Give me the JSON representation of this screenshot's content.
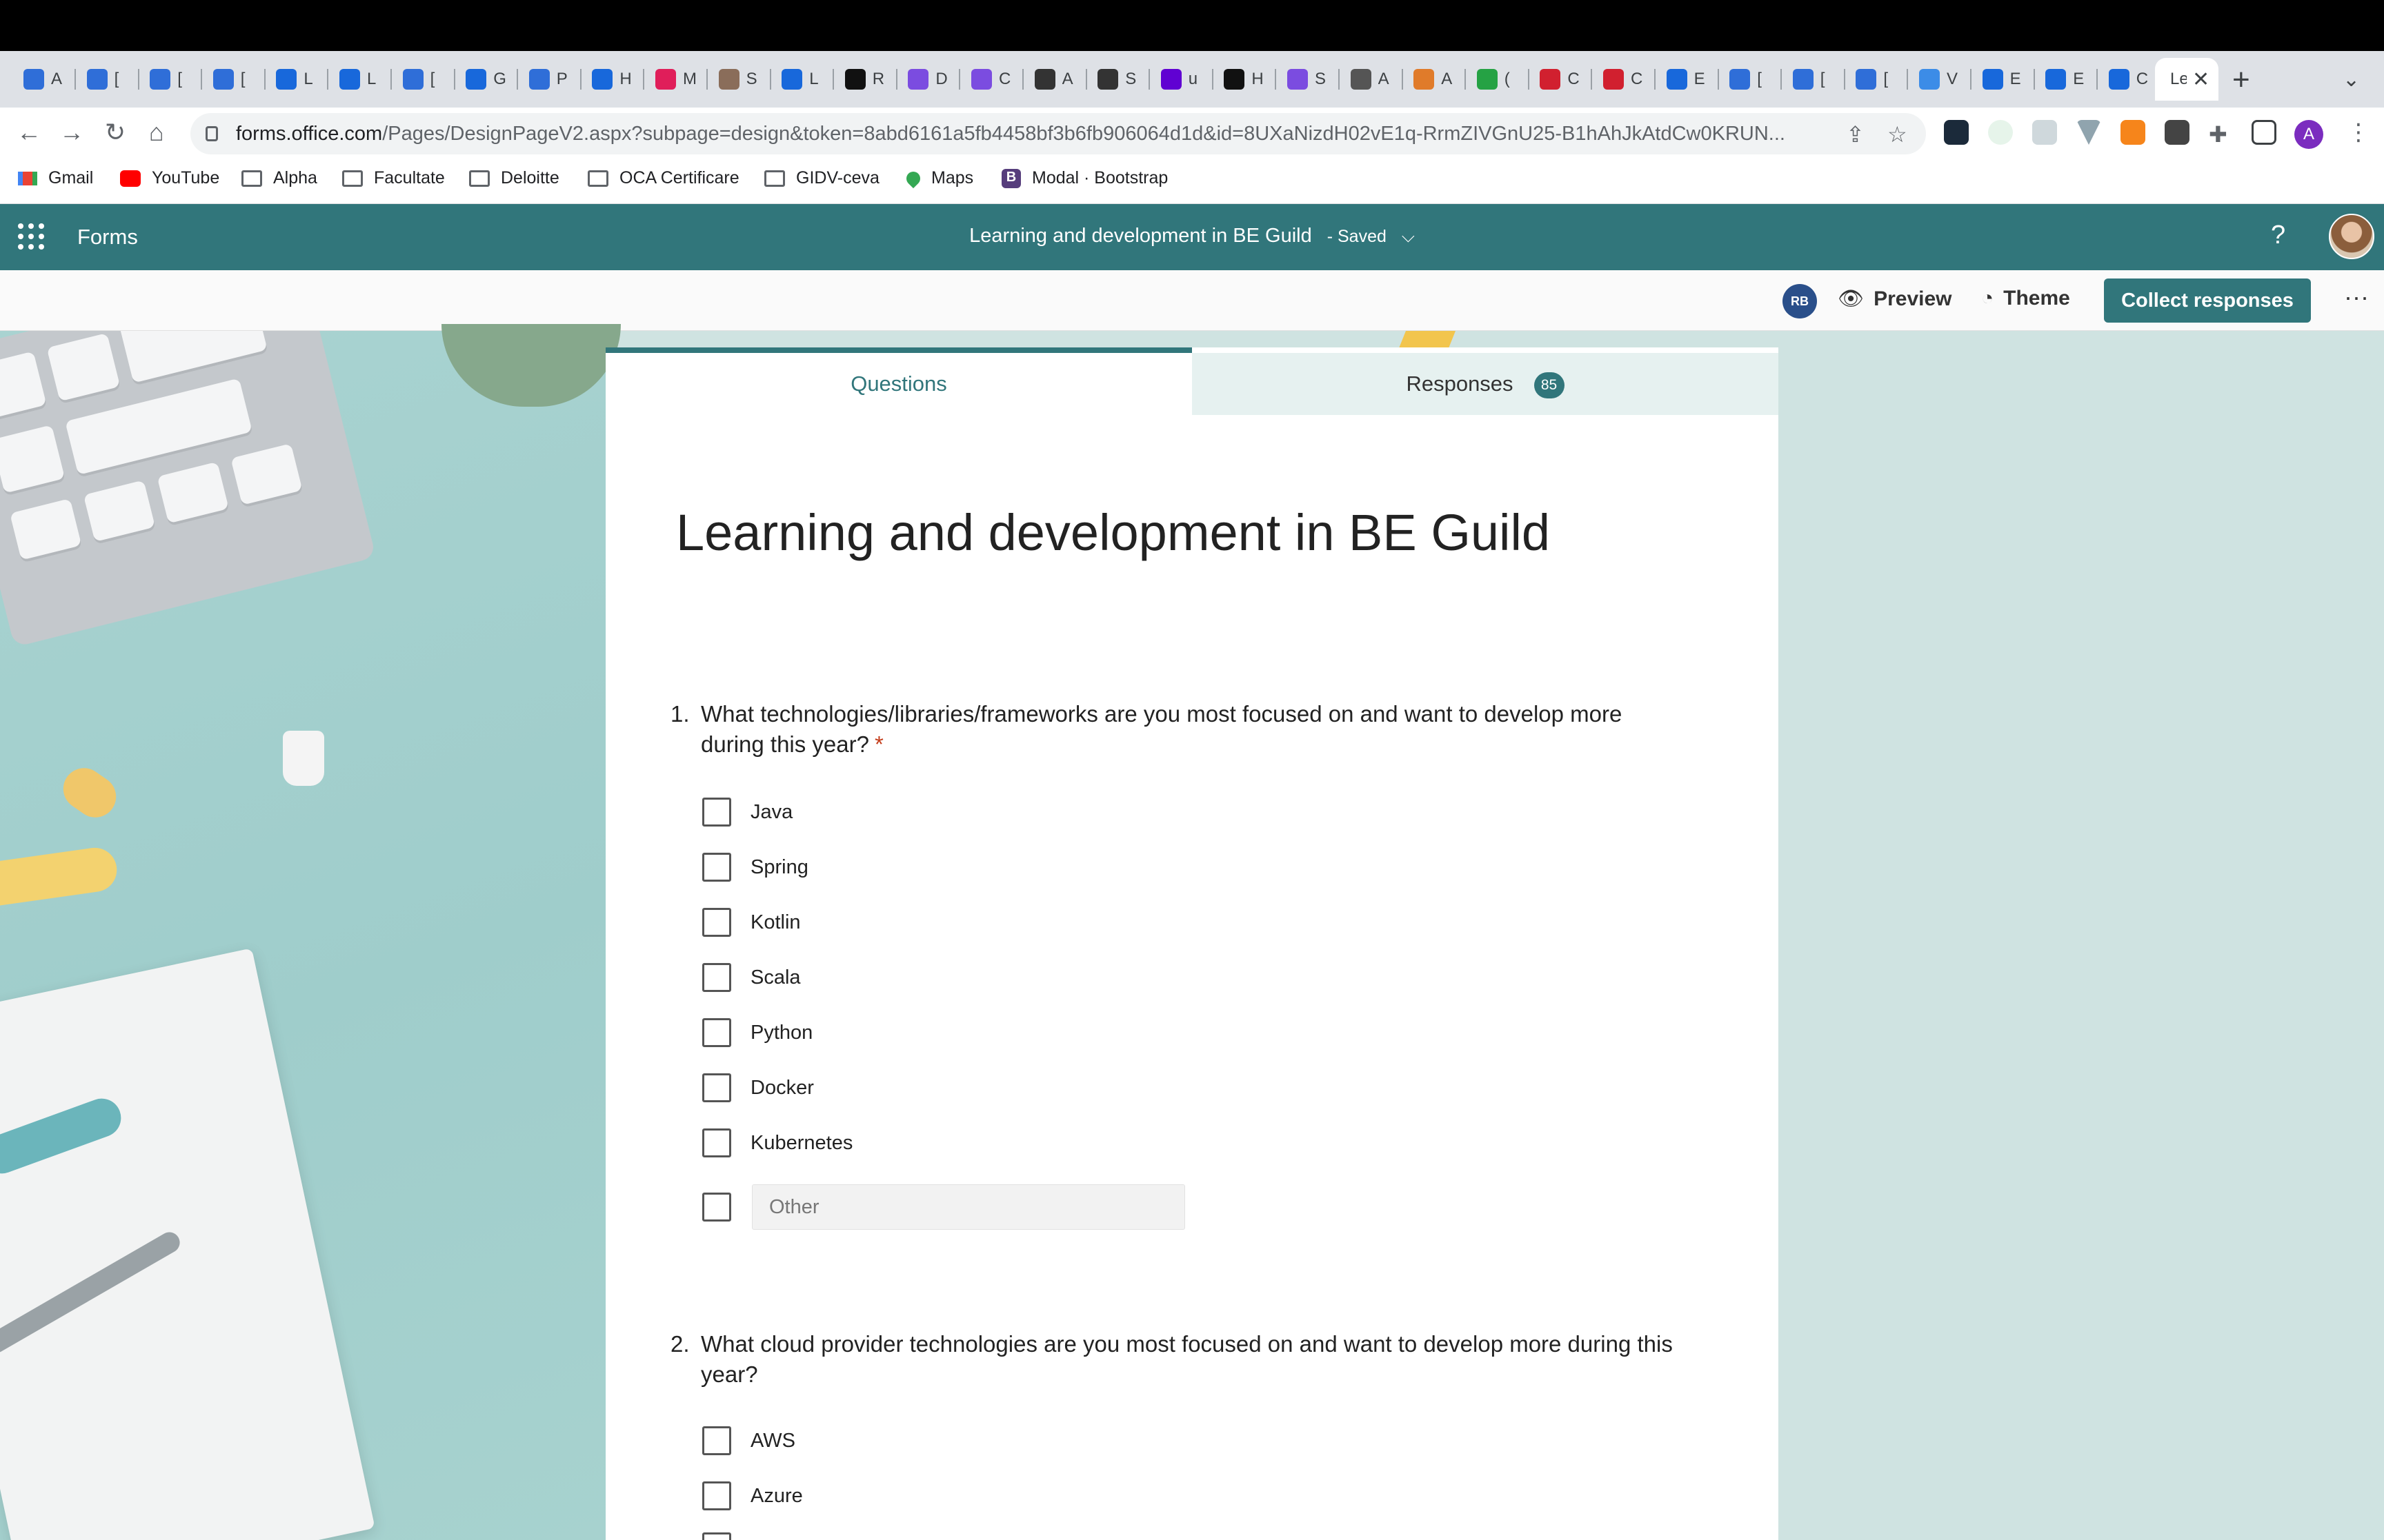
{
  "browser": {
    "tabs": [
      {
        "title": "A",
        "color": "#2f6ed8"
      },
      {
        "title": "[",
        "color": "#2f6ed8"
      },
      {
        "title": "[",
        "color": "#2f6ed8"
      },
      {
        "title": "[",
        "color": "#2f6ed8"
      },
      {
        "title": "L",
        "color": "#1868db"
      },
      {
        "title": "L",
        "color": "#1868db"
      },
      {
        "title": "[",
        "color": "#2f6ed8"
      },
      {
        "title": "G",
        "color": "#1868db"
      },
      {
        "title": "P",
        "color": "#2f6ed8"
      },
      {
        "title": "H",
        "color": "#1868db"
      },
      {
        "title": "M",
        "color": "#e01e5a"
      },
      {
        "title": "S",
        "color": "#8a6d5a"
      },
      {
        "title": "L",
        "color": "#1868db"
      },
      {
        "title": "R",
        "color": "#111111"
      },
      {
        "title": "D",
        "color": "#7b4ce0"
      },
      {
        "title": "C",
        "color": "#7b4ce0"
      },
      {
        "title": "A",
        "color": "#333333"
      },
      {
        "title": "S",
        "color": "#333333"
      },
      {
        "title": "u",
        "color": "#6001d2"
      },
      {
        "title": "H",
        "color": "#111111"
      },
      {
        "title": "S",
        "color": "#7b4ce0"
      },
      {
        "title": "A",
        "color": "#555555"
      },
      {
        "title": "A",
        "color": "#e07b2a"
      },
      {
        "title": "(",
        "color": "#25a244"
      },
      {
        "title": "C",
        "color": "#d1202f"
      },
      {
        "title": "C",
        "color": "#d1202f"
      },
      {
        "title": "E",
        "color": "#1868db"
      },
      {
        "title": "[",
        "color": "#2f6ed8"
      },
      {
        "title": "[",
        "color": "#2f6ed8"
      },
      {
        "title": "[",
        "color": "#2f6ed8"
      },
      {
        "title": "V",
        "color": "#3c8ce7"
      },
      {
        "title": "E",
        "color": "#1868db"
      },
      {
        "title": "E",
        "color": "#1868db"
      },
      {
        "title": "C",
        "color": "#1868db"
      }
    ],
    "active_tab": {
      "title": "Le",
      "close": "✕"
    },
    "new_tab": "+",
    "url_main": "forms.office.com",
    "url_rest": "/Pages/DesignPageV2.aspx?subpage=design&token=8abd6161a5fb4458bf3b6fb906064d1d&id=8UXaNizdH02vE1q-RrmZIVGnU25-B1hAhJkAtdCw0KRUN...",
    "profile_initial": "A"
  },
  "bookmarks": [
    {
      "label": "Gmail",
      "icon": "gmail-icon"
    },
    {
      "label": "YouTube",
      "icon": "youtube-icon"
    },
    {
      "label": "Alpha",
      "icon": "folder-icon"
    },
    {
      "label": "Facultate",
      "icon": "folder-icon"
    },
    {
      "label": "Deloitte",
      "icon": "folder-icon"
    },
    {
      "label": "OCA Certificare",
      "icon": "folder-icon"
    },
    {
      "label": "GIDV-ceva",
      "icon": "folder-icon"
    },
    {
      "label": "Maps",
      "icon": "maps-icon"
    },
    {
      "label": "Modal · Bootstrap",
      "icon": "bootstrap-icon"
    }
  ],
  "forms_header": {
    "app_name": "Forms",
    "form_title": "Learning and development in BE Guild",
    "saved_status": "-  Saved",
    "help": "?",
    "accent_color": "#31767b"
  },
  "toolbar": {
    "avatar_initials": "RB",
    "preview_label": "Preview",
    "theme_label": "Theme",
    "collect_label": "Collect responses",
    "more": "···"
  },
  "tabs": {
    "questions_label": "Questions",
    "responses_label": "Responses",
    "responses_count": "85"
  },
  "form": {
    "title": "Learning and development in BE Guild",
    "questions": [
      {
        "number": "1.",
        "text": "What technologies/libraries/frameworks are you most focused on and want to develop more during this year?",
        "required_mark": "*",
        "options": [
          "Java",
          "Spring",
          "Kotlin",
          "Scala",
          "Python",
          "Docker",
          "Kubernetes"
        ],
        "other_placeholder": "Other"
      },
      {
        "number": "2.",
        "text": "What cloud provider technologies are you most focused on and want to develop more during this year?",
        "options": [
          "AWS",
          "Azure"
        ]
      }
    ]
  }
}
